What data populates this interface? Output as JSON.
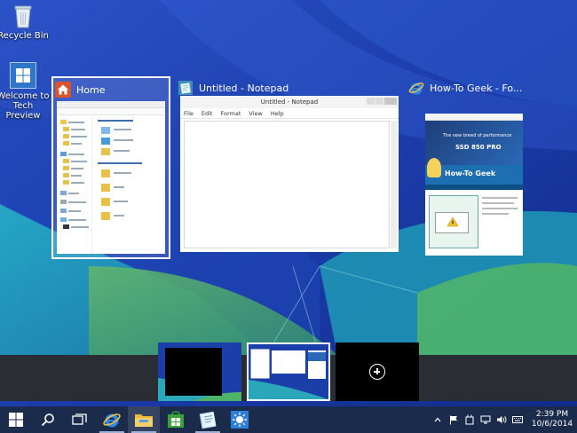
{
  "desktop": {
    "icons": [
      {
        "label": "Recycle Bin",
        "icon": "recycle-bin-icon"
      },
      {
        "label": "Welcome to Tech Preview",
        "icon": "windows-logo-icon"
      }
    ]
  },
  "task_view": {
    "windows": [
      {
        "title": "Home",
        "icon": "explorer-home-icon",
        "selected": true,
        "thumbnail": {
          "titlebar": "Home",
          "nav_items": [
            "Favorites",
            "Desktop",
            "Downloads",
            "Videos",
            "OneDrive",
            "Documents",
            "Pictures",
            "Public",
            "Transfer",
            "This PC",
            "Local Disk (C:)",
            "Network",
            "Homegroup",
            "Chris Hoffman"
          ],
          "sections": [
            "Favorites (4)",
            "Frequent folders (4)"
          ],
          "items": [
            "Desktop",
            "Downloads",
            "Videos",
            "Documents",
            "Music",
            "Pictures",
            "Videos"
          ]
        }
      },
      {
        "title": "Untitled - Notepad",
        "icon": "notepad-icon",
        "selected": false,
        "thumbnail": {
          "titlebar": "Untitled - Notepad",
          "menu": [
            "File",
            "Edit",
            "Format",
            "View",
            "Help"
          ]
        }
      },
      {
        "title": "How-To Geek - Fo...",
        "icon": "internet-explorer-icon",
        "selected": false,
        "thumbnail": {
          "banner_line1": "The new breed of performance",
          "banner_line2": "SSD 850 PRO",
          "site_logo": "How-To Geek"
        }
      }
    ]
  },
  "virtual_desktops": {
    "desktops": [
      {
        "name": "desktop-1",
        "active": false
      },
      {
        "name": "desktop-2",
        "active": true
      }
    ],
    "add_icon": "plus-circle-icon"
  },
  "taskbar": {
    "buttons": [
      {
        "name": "start-button",
        "icon": "windows-start-icon"
      },
      {
        "name": "search-button",
        "icon": "search-icon"
      },
      {
        "name": "task-view-button",
        "icon": "task-view-icon"
      },
      {
        "name": "internet-explorer-button",
        "icon": "internet-explorer-icon"
      },
      {
        "name": "file-explorer-button",
        "icon": "file-explorer-icon"
      },
      {
        "name": "store-button",
        "icon": "store-icon"
      },
      {
        "name": "notepad-button",
        "icon": "notepad-icon"
      },
      {
        "name": "weather-button",
        "icon": "sun-icon"
      }
    ],
    "tray": {
      "icons": [
        "chevron-up-icon",
        "flag-icon",
        "power-icon",
        "network-icon",
        "volume-icon",
        "keyboard-icon"
      ],
      "time": "2:39 PM",
      "date": "10/6/2014"
    }
  },
  "colors": {
    "taskbar": "#1b2b4c",
    "vd_bar": "#2a2d33",
    "accent_blue": "#1b3fa8"
  }
}
